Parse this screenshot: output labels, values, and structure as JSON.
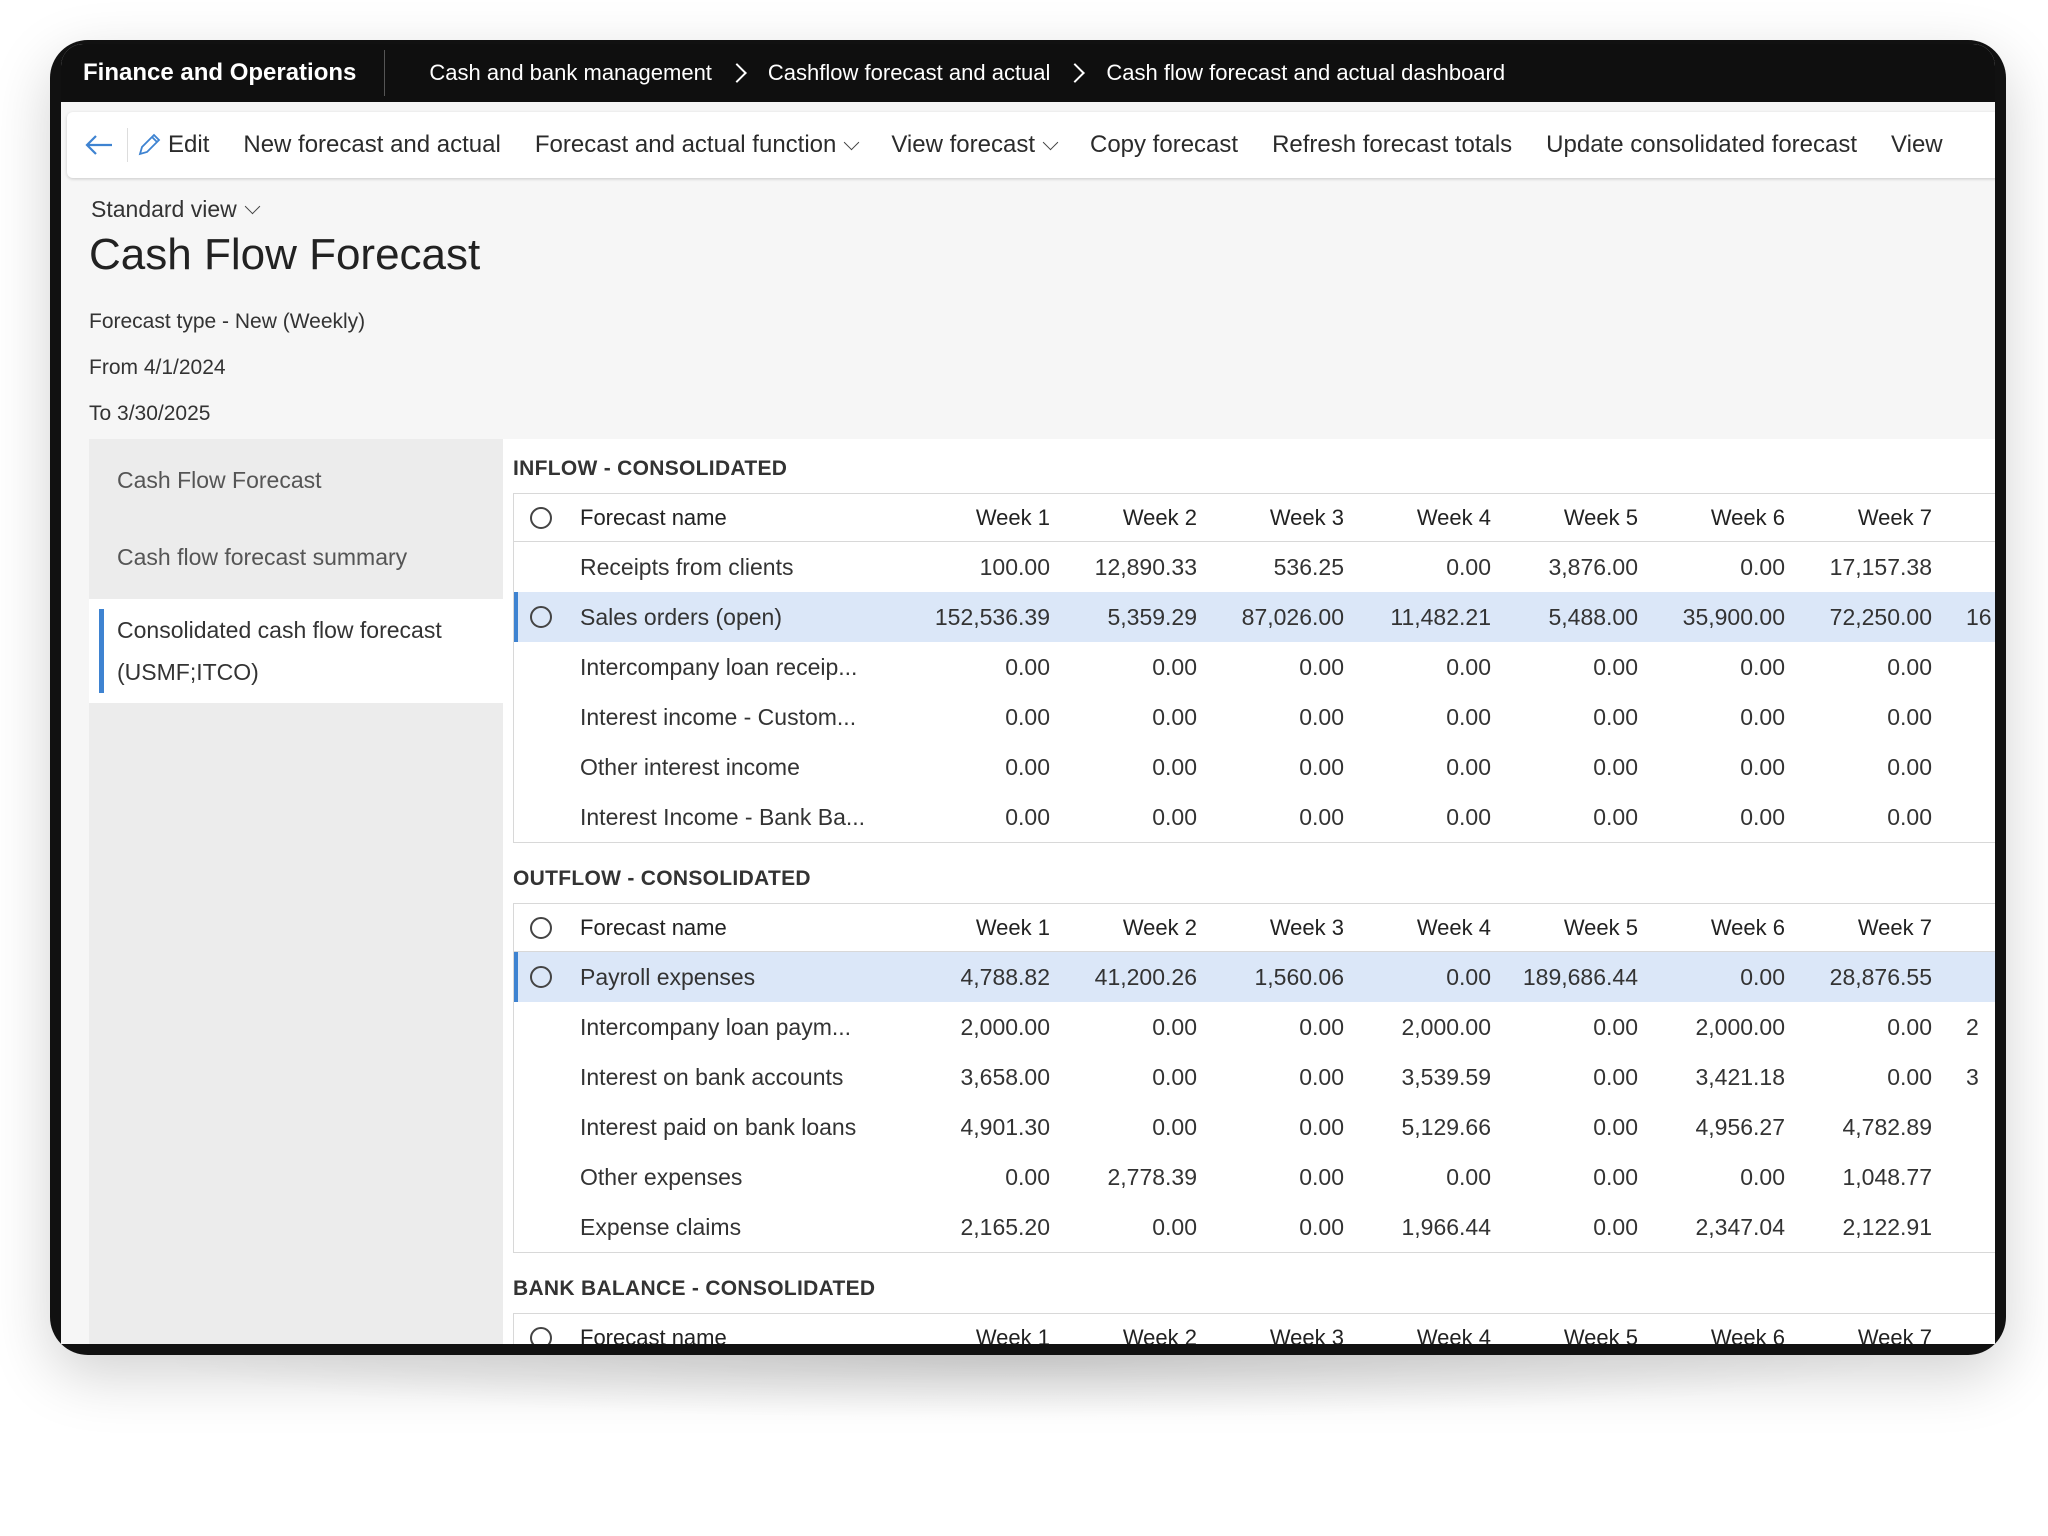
{
  "app_title": "Finance and Operations",
  "breadcrumbs": [
    "Cash and bank management",
    "Cashflow forecast and actual",
    "Cash flow forecast and actual dashboard"
  ],
  "actions": {
    "edit": "Edit",
    "new_forecast": "New forecast and actual",
    "forecast_function": "Forecast and actual function",
    "view_forecast": "View forecast",
    "copy_forecast": "Copy forecast",
    "refresh_totals": "Refresh forecast totals",
    "update_consolidated": "Update consolidated forecast",
    "view_more": "View"
  },
  "view_selector": "Standard view",
  "page_title": "Cash Flow Forecast",
  "meta": {
    "forecast_type": "Forecast type - New (Weekly)",
    "from": "From 4/1/2024",
    "to": "To 3/30/2025"
  },
  "nav": {
    "item1": "Cash Flow Forecast",
    "item2": "Cash flow forecast summary",
    "item3_line1": "Consolidated cash flow forecast",
    "item3_line2": "(USMF;ITCO)"
  },
  "columns": {
    "name": "Forecast name",
    "weeks": [
      "Week 1",
      "Week 2",
      "Week 3",
      "Week 4",
      "Week 5",
      "Week 6",
      "Week 7"
    ]
  },
  "inflow": {
    "title": "INFLOW - CONSOLIDATED",
    "rows": [
      {
        "name": "Receipts from clients",
        "values": [
          "100.00",
          "12,890.33",
          "536.25",
          "0.00",
          "3,876.00",
          "0.00",
          "17,157.38"
        ],
        "extra": ""
      },
      {
        "name": "Sales orders (open)",
        "values": [
          "152,536.39",
          "5,359.29",
          "87,026.00",
          "11,482.21",
          "5,488.00",
          "35,900.00",
          "72,250.00"
        ],
        "extra": "16"
      },
      {
        "name": "Intercompany loan receip...",
        "values": [
          "0.00",
          "0.00",
          "0.00",
          "0.00",
          "0.00",
          "0.00",
          "0.00"
        ],
        "extra": ""
      },
      {
        "name": "Interest income - Custom...",
        "values": [
          "0.00",
          "0.00",
          "0.00",
          "0.00",
          "0.00",
          "0.00",
          "0.00"
        ],
        "extra": ""
      },
      {
        "name": "Other interest income",
        "values": [
          "0.00",
          "0.00",
          "0.00",
          "0.00",
          "0.00",
          "0.00",
          "0.00"
        ],
        "extra": ""
      },
      {
        "name": "Interest Income - Bank Ba...",
        "values": [
          "0.00",
          "0.00",
          "0.00",
          "0.00",
          "0.00",
          "0.00",
          "0.00"
        ],
        "extra": ""
      }
    ]
  },
  "outflow": {
    "title": "OUTFLOW - CONSOLIDATED",
    "rows": [
      {
        "name": "Payroll expenses",
        "values": [
          "4,788.82",
          "41,200.26",
          "1,560.06",
          "0.00",
          "189,686.44",
          "0.00",
          "28,876.55"
        ],
        "extra": ""
      },
      {
        "name": "Intercompany loan paym...",
        "values": [
          "2,000.00",
          "0.00",
          "0.00",
          "2,000.00",
          "0.00",
          "2,000.00",
          "0.00"
        ],
        "extra": "2"
      },
      {
        "name": "Interest on bank accounts",
        "values": [
          "3,658.00",
          "0.00",
          "0.00",
          "3,539.59",
          "0.00",
          "3,421.18",
          "0.00"
        ],
        "extra": "3"
      },
      {
        "name": "Interest paid on bank loans",
        "values": [
          "4,901.30",
          "0.00",
          "0.00",
          "5,129.66",
          "0.00",
          "4,956.27",
          "4,782.89"
        ],
        "extra": ""
      },
      {
        "name": "Other expenses",
        "values": [
          "0.00",
          "2,778.39",
          "0.00",
          "0.00",
          "0.00",
          "0.00",
          "1,048.77"
        ],
        "extra": ""
      },
      {
        "name": "Expense claims",
        "values": [
          "2,165.20",
          "0.00",
          "0.00",
          "1,966.44",
          "0.00",
          "2,347.04",
          "2,122.91"
        ],
        "extra": ""
      }
    ]
  },
  "bank": {
    "title": "BANK BALANCE - CONSOLIDATED"
  }
}
